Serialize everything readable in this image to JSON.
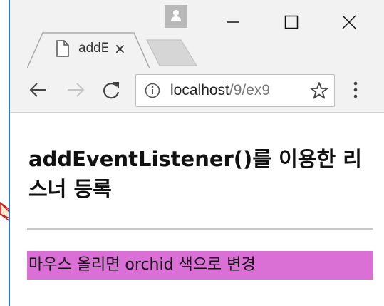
{
  "browser": {
    "tab_title": "addE",
    "tab_close": "×",
    "url_host": "localhost",
    "url_path": "/9/ex9",
    "icons": {
      "user": "user-profile-icon",
      "minimize": "minimize-icon",
      "maximize": "maximize-icon",
      "close": "close-icon",
      "favicon": "page-icon",
      "back": "back-arrow-icon",
      "forward": "forward-arrow-icon",
      "reload": "reload-icon",
      "info": "info-icon",
      "bookmark": "star-icon",
      "menu": "kebab-menu-icon"
    }
  },
  "page": {
    "heading": "addEventListener()를 이용한 리스너 등록",
    "hover_text": "마우스 올리면 orchid 색으로 변경",
    "hover_color": "#da70d6"
  }
}
